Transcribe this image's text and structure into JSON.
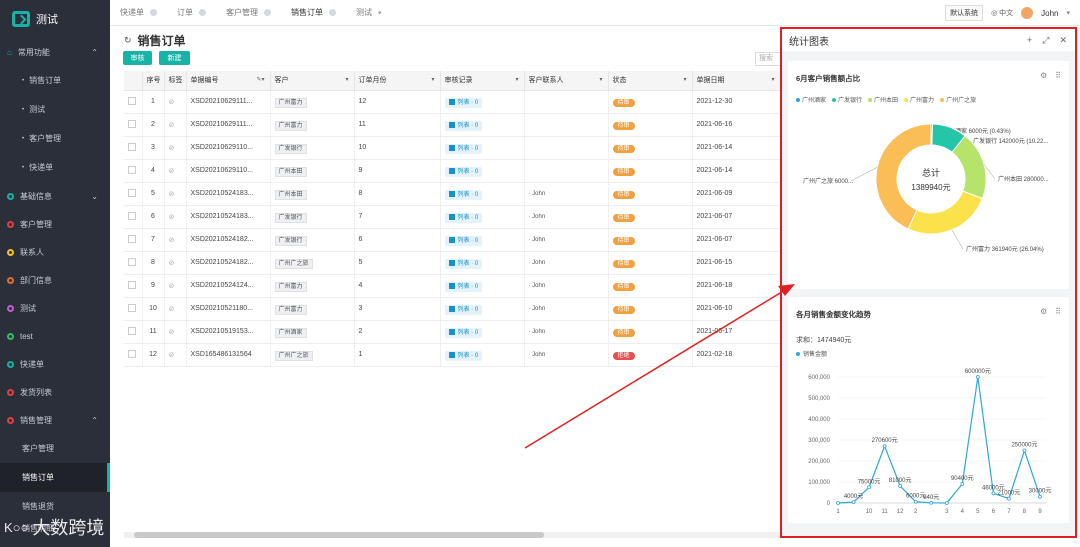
{
  "app": {
    "logo_text": "测试"
  },
  "sidebar": {
    "groups": [
      {
        "label": "常用功能",
        "color": "#18b3a7"
      },
      {
        "label": "基础信息",
        "color": "#18b3a7"
      },
      {
        "label": "客户管理",
        "color": "#e04040"
      },
      {
        "label": "联系人",
        "color": "#f5c518"
      },
      {
        "label": "部门信息",
        "color": "#e07030"
      },
      {
        "label": "测试",
        "color": "#c060d0"
      },
      {
        "label": "test",
        "color": "#30c060"
      },
      {
        "label": "快递单",
        "color": "#18b3a7"
      },
      {
        "label": "发货列表",
        "color": "#e04040"
      },
      {
        "label": "销售管理",
        "color": "#e04040"
      }
    ],
    "common_items": [
      "销售订单",
      "测试",
      "客户管理",
      "快递单"
    ],
    "sales_items": [
      "客户管理",
      "销售订单",
      "销售退货",
      "销售明细"
    ]
  },
  "tabs": [
    "快递单",
    "订单",
    "客户管理",
    "销售订单",
    "测试"
  ],
  "topbar": {
    "sys_label": "默认系统",
    "lang_label": "中文",
    "user": "John"
  },
  "page": {
    "title": "销售订单",
    "audit_btn": "审核",
    "new_btn": "新建",
    "search_placeholder": "搜索"
  },
  "table": {
    "headers": [
      "序号",
      "标签",
      "单据编号",
      "客户",
      "订单月份",
      "审核记录",
      "客户联系人",
      "状态",
      "单据日期"
    ],
    "audit_text": "列表 · 0",
    "rows": [
      {
        "no": "1",
        "code": "XSD20210629111...",
        "customer": "广州富力",
        "month": "12",
        "contact": "",
        "status": "待审",
        "date": "2021-12-30"
      },
      {
        "no": "2",
        "code": "XSD20210629111...",
        "customer": "广州富力",
        "month": "11",
        "contact": "",
        "status": "待审",
        "date": "2021-06-16"
      },
      {
        "no": "3",
        "code": "XSD20210629110...",
        "customer": "广发银行",
        "month": "10",
        "contact": "",
        "status": "待审",
        "date": "2021-06-14"
      },
      {
        "no": "4",
        "code": "XSD20210629110...",
        "customer": "广州本田",
        "month": "9",
        "contact": "",
        "status": "待审",
        "date": "2021-06-14"
      },
      {
        "no": "5",
        "code": "XSD20210524183...",
        "customer": "广州本田",
        "month": "8",
        "contact": "John",
        "status": "待审",
        "date": "2021-06-09"
      },
      {
        "no": "6",
        "code": "XSD20210524183...",
        "customer": "广发银行",
        "month": "7",
        "contact": "John",
        "status": "待审",
        "date": "2021-06-07"
      },
      {
        "no": "7",
        "code": "XSD20210524182...",
        "customer": "广发银行",
        "month": "6",
        "contact": "John",
        "status": "待审",
        "date": "2021-06-07"
      },
      {
        "no": "8",
        "code": "XSD20210524182...",
        "customer": "广州广之旅",
        "month": "5",
        "contact": "John",
        "status": "待审",
        "date": "2021-06-15"
      },
      {
        "no": "9",
        "code": "XSD20210524124...",
        "customer": "广州富力",
        "month": "4",
        "contact": "John",
        "status": "待审",
        "date": "2021-06-18"
      },
      {
        "no": "10",
        "code": "XSD20210521180...",
        "customer": "广州富力",
        "month": "3",
        "contact": "John",
        "status": "待审",
        "date": "2021-06-10"
      },
      {
        "no": "11",
        "code": "XSD20210519153...",
        "customer": "广州酒家",
        "month": "2",
        "contact": "John",
        "status": "待审",
        "date": "2021-06-17"
      },
      {
        "no": "12",
        "code": "XSD165486131564",
        "customer": "广州广之旅",
        "month": "1",
        "contact": "John",
        "status": "拒绝",
        "date": "2021-02-18"
      }
    ],
    "status_colors": {
      "待审": "#f0a040",
      "拒绝": "#e85050"
    }
  },
  "panel": {
    "title": "统计图表"
  },
  "chart_data": [
    {
      "type": "pie",
      "title": "6月客户销售额占比",
      "center_label": "总计",
      "center_value": "1389940元",
      "categories": [
        "广州酒家",
        "广发银行",
        "广州本田",
        "广州富力",
        "广州广之旅"
      ],
      "values": [
        6000,
        142000,
        280000,
        361940,
        600000
      ],
      "colors": [
        "#2ea6d8",
        "#23c6a8",
        "#b6e36a",
        "#fbe14a",
        "#fbbd56"
      ],
      "slice_labels": [
        "广州酒家 6000元 (0.43%)",
        "广发银行 142000元 (10.22...",
        "广州本田 280000...",
        "广州富力 361940元 (26.04%)",
        "广州广之旅 6000..."
      ]
    },
    {
      "type": "line",
      "title": "各月销售金额变化趋势",
      "summary": "求和：1474940元",
      "series": [
        {
          "name": "销售金额",
          "values": [
            0,
            4000,
            75000,
            270600,
            81000,
            6000,
            940,
            0,
            90400,
            600000,
            46000,
            21000,
            250000,
            30000
          ]
        }
      ],
      "x": [
        "1",
        "",
        "10",
        "11",
        "12",
        "2",
        "",
        "3",
        "4",
        "5",
        "6",
        "7",
        "8",
        "9"
      ],
      "point_labels": [
        "",
        "4000元",
        "75000元",
        "270600元",
        "81000元",
        "6000元",
        "940元",
        "",
        "90400元",
        "600000元",
        "46000元",
        "21000元",
        "250000元",
        "30000元"
      ],
      "yticks": [
        "0",
        "100,000",
        "200,000",
        "300,000",
        "400,000",
        "500,000",
        "600,000"
      ],
      "ylim": [
        0,
        600000
      ],
      "color": "#2ea6d8"
    }
  ],
  "watermark": "大数跨境"
}
